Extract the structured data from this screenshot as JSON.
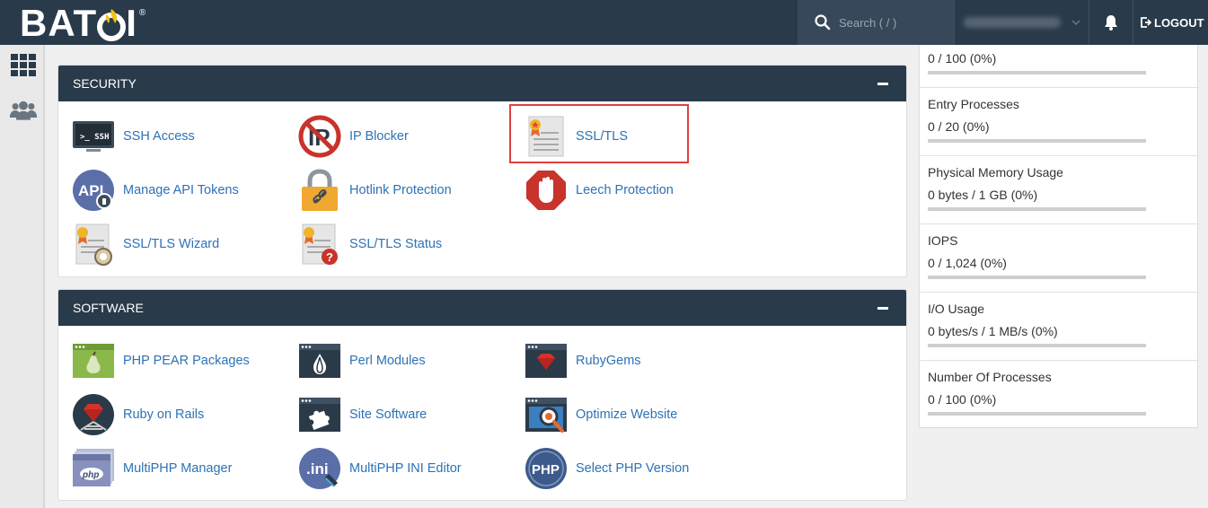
{
  "header": {
    "logo_text": "BAT",
    "logo_text_after": "I",
    "logo_reg": "®",
    "search_placeholder": "Search ( / )",
    "logout_label": "LOGOUT"
  },
  "panels": [
    {
      "title": "SECURITY",
      "items": [
        {
          "label": "SSH Access",
          "icon": "terminal-icon"
        },
        {
          "label": "IP Blocker",
          "icon": "ip-blocker-icon"
        },
        {
          "label": "SSL/TLS",
          "icon": "certificate-icon"
        },
        {
          "label": "Manage API Tokens",
          "icon": "api-icon"
        },
        {
          "label": "Hotlink Protection",
          "icon": "padlock-icon"
        },
        {
          "label": "Leech Protection",
          "icon": "stop-hand-icon"
        },
        {
          "label": "SSL/TLS Wizard",
          "icon": "certificate-wizard-icon"
        },
        {
          "label": "SSL/TLS Status",
          "icon": "certificate-status-icon"
        }
      ]
    },
    {
      "title": "SOFTWARE",
      "items": [
        {
          "label": "PHP PEAR Packages",
          "icon": "pear-icon"
        },
        {
          "label": "Perl Modules",
          "icon": "perl-onion-icon"
        },
        {
          "label": "RubyGems",
          "icon": "ruby-gem-icon"
        },
        {
          "label": "Ruby on Rails",
          "icon": "rails-icon"
        },
        {
          "label": "Site Software",
          "icon": "puzzle-icon"
        },
        {
          "label": "Optimize Website",
          "icon": "optimize-icon"
        },
        {
          "label": "MultiPHP Manager",
          "icon": "multiphp-icon"
        },
        {
          "label": "MultiPHP INI Editor",
          "icon": "ini-editor-icon"
        },
        {
          "label": "Select PHP Version",
          "icon": "php-version-icon"
        }
      ]
    }
  ],
  "stats": [
    {
      "label": "",
      "value": "0 / 100   (0%)",
      "percent": 0
    },
    {
      "label": "Entry Processes",
      "value": "0 / 20   (0%)",
      "percent": 0
    },
    {
      "label": "Physical Memory Usage",
      "value": "0 bytes / 1 GB   (0%)",
      "percent": 0
    },
    {
      "label": "IOPS",
      "value": "0 / 1,024   (0%)",
      "percent": 0
    },
    {
      "label": "I/O Usage",
      "value": "0 bytes/s / 1 MB/s   (0%)",
      "percent": 0
    },
    {
      "label": "Number Of Processes",
      "value": "0 / 100   (0%)",
      "percent": 0
    }
  ],
  "colors": {
    "topbar": "#293a4a",
    "link": "#2d72b6",
    "highlight": "#e04040"
  }
}
